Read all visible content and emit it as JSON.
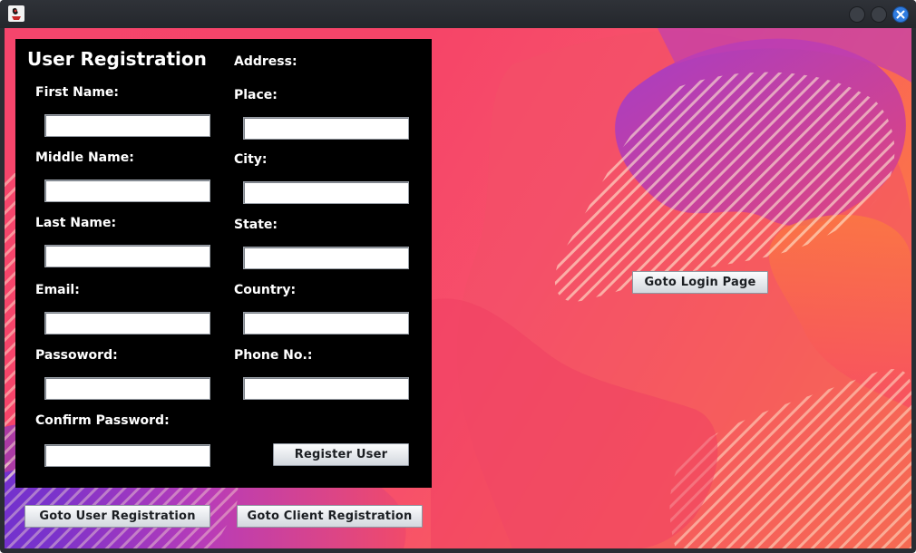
{
  "window": {
    "app_icon": "java-duke-icon",
    "controls": [
      "minimize-button",
      "maximize-button",
      "close-button"
    ],
    "accent_color": "#2f7ce0"
  },
  "form": {
    "title": "User Registration",
    "address_heading": "Address:",
    "left_fields": [
      {
        "label": "First Name:",
        "value": ""
      },
      {
        "label": "Middle Name:",
        "value": ""
      },
      {
        "label": "Last Name:",
        "value": ""
      },
      {
        "label": "Email:",
        "value": ""
      },
      {
        "label": "Passoword:",
        "value": ""
      },
      {
        "label": "Confirm Password:",
        "value": ""
      }
    ],
    "right_fields": [
      {
        "label": "Place:",
        "value": ""
      },
      {
        "label": "City:",
        "value": ""
      },
      {
        "label": "State:",
        "value": ""
      },
      {
        "label": "Country:",
        "value": ""
      },
      {
        "label": "Phone No.:",
        "value": ""
      }
    ],
    "register_button": "Register User"
  },
  "navigation": {
    "login_button": "Goto Login Page",
    "user_registration_button": "Goto User Registration",
    "client_registration_button": "Goto Client Registration"
  },
  "colors": {
    "panel_background": "#000000",
    "background_pink": "#f64468",
    "background_orange": "#f98a39",
    "background_purple": "#b03fc0"
  }
}
